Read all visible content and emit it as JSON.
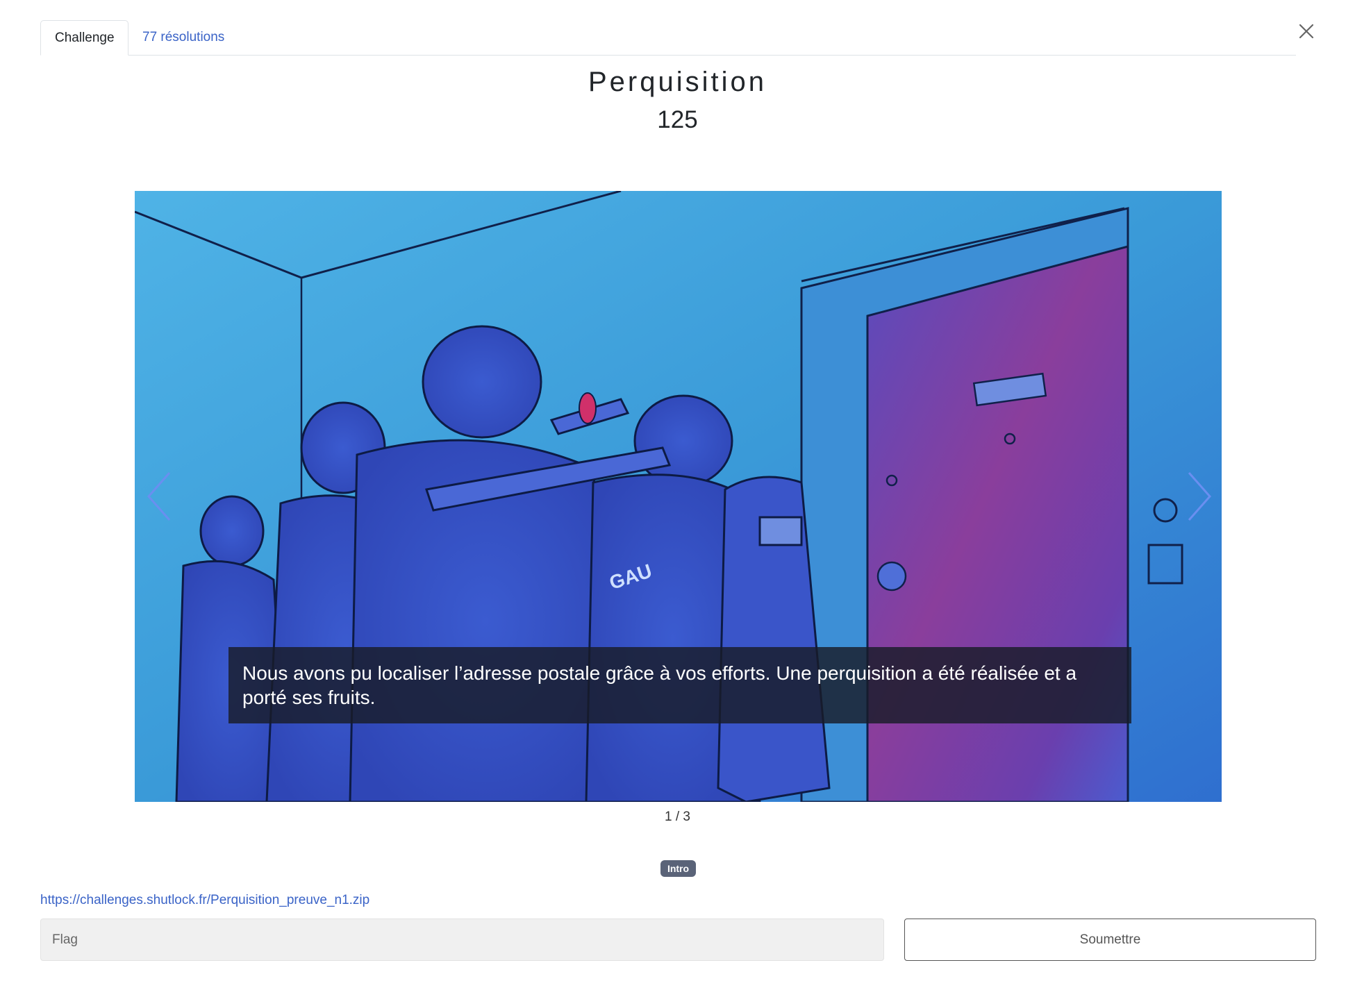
{
  "tabs": [
    {
      "label": "Challenge",
      "active": true
    },
    {
      "label": "77 résolutions",
      "active": false
    }
  ],
  "challenge": {
    "title": "Perquisition",
    "points": "125"
  },
  "carousel": {
    "caption": "Nous avons pu localiser l’adresse postale grâce à vos efforts. Une perquisition a été réalisée et a porté ses fruits.",
    "counter": "1 / 3",
    "image_text": "GAU"
  },
  "badge": "Intro",
  "file_link": "https://challenges.shutlock.fr/Perquisition_preuve_n1.zip",
  "form": {
    "flag_placeholder": "Flag",
    "submit_label": "Soumettre"
  },
  "colors": {
    "link": "#3a63c7",
    "badge": "#5a6378",
    "image_blue": "#3aa0d8",
    "image_purple": "#7a3c9e"
  }
}
